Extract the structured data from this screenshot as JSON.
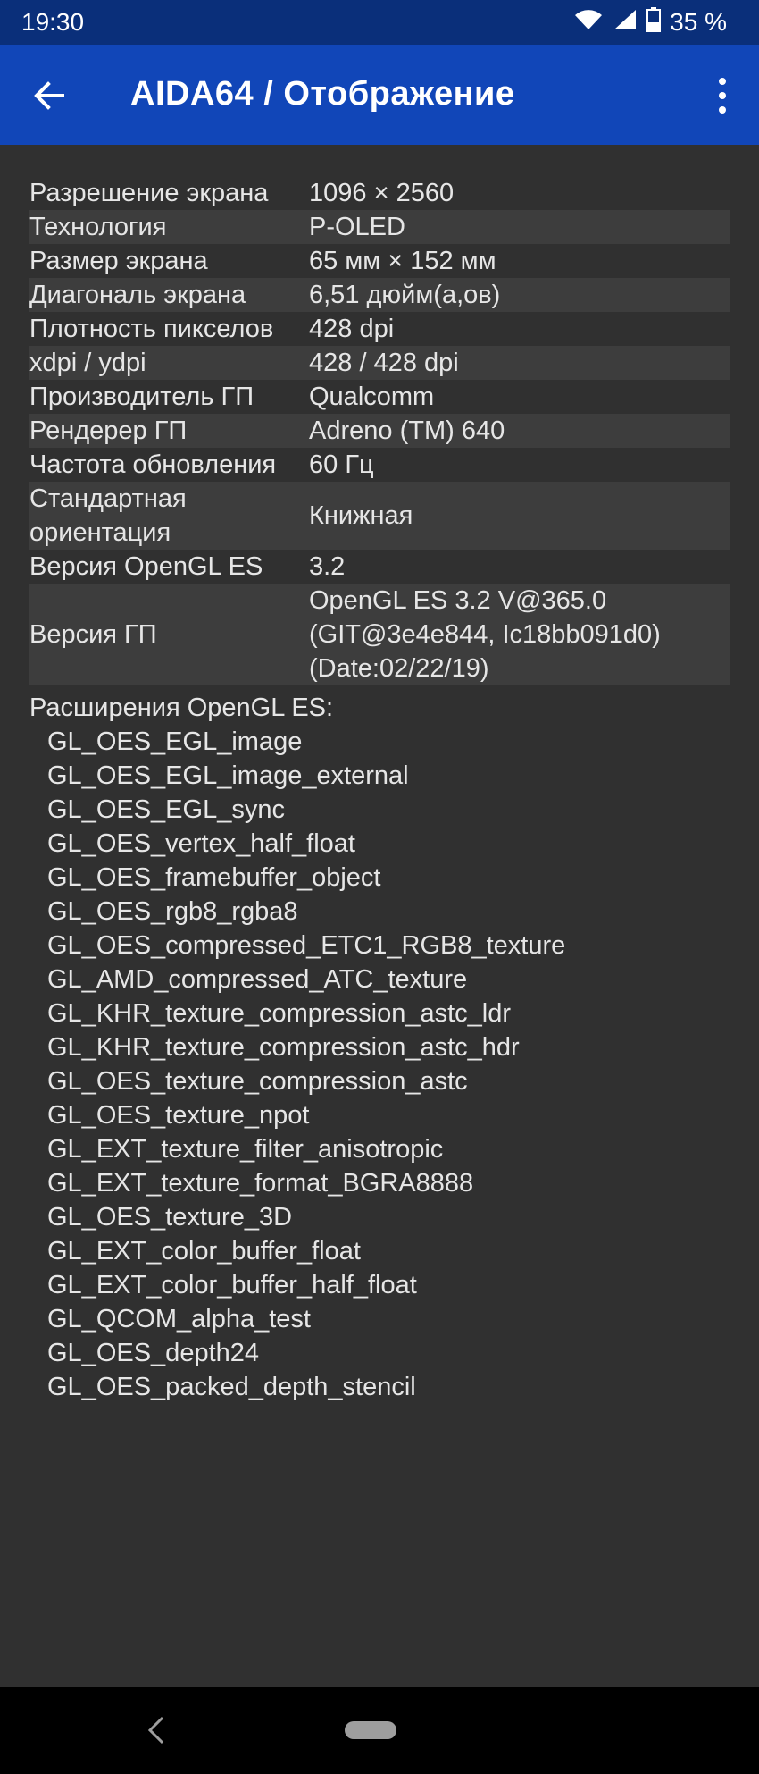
{
  "status_bar": {
    "time": "19:30",
    "battery": "35 %",
    "icons": [
      "wifi-icon",
      "signal-icon",
      "battery-icon"
    ]
  },
  "app_bar": {
    "title": "AIDA64  /  Отображение",
    "back_icon": "arrow-left-icon",
    "menu_icon": "more-vert-icon",
    "color": "#1146b8"
  },
  "rows": [
    {
      "label": "Разрешение экрана",
      "value": "1096 × 2560",
      "shaded": false
    },
    {
      "label": "Технология",
      "value": "P-OLED",
      "shaded": true
    },
    {
      "label": "Размер экрана",
      "value": "65 мм × 152 мм",
      "shaded": false
    },
    {
      "label": "Диагональ экрана",
      "value": "6,51 дюйм(а,ов)",
      "shaded": true
    },
    {
      "label": "Плотность пикселов",
      "value": "428 dpi",
      "shaded": false
    },
    {
      "label": "xdpi / ydpi",
      "value": "428 / 428 dpi",
      "shaded": true
    },
    {
      "label": "Производитель ГП",
      "value": "Qualcomm",
      "shaded": false
    },
    {
      "label": "Рендерер ГП",
      "value": "Adreno (TM) 640",
      "shaded": true
    },
    {
      "label": "Частота обновления",
      "value": "60 Гц",
      "shaded": false
    },
    {
      "label": "Стандартная ориентация",
      "value": "Книжная",
      "shaded": true
    },
    {
      "label": "Версия OpenGL ES",
      "value": "3.2",
      "shaded": false
    },
    {
      "label": "Версия ГП",
      "value": "OpenGL ES 3.2 V@365.0 (GIT@3e4e844, Ic18bb091d0) (Date:02/22/19)",
      "shaded": true
    }
  ],
  "extensions": {
    "header": "Расширения OpenGL ES:",
    "items": [
      "GL_OES_EGL_image",
      "GL_OES_EGL_image_external",
      "GL_OES_EGL_sync",
      "GL_OES_vertex_half_float",
      "GL_OES_framebuffer_object",
      "GL_OES_rgb8_rgba8",
      "GL_OES_compressed_ETC1_RGB8_texture",
      "GL_AMD_compressed_ATC_texture",
      "GL_KHR_texture_compression_astc_ldr",
      "GL_KHR_texture_compression_astc_hdr",
      "GL_OES_texture_compression_astc",
      "GL_OES_texture_npot",
      "GL_EXT_texture_filter_anisotropic",
      "GL_EXT_texture_format_BGRA8888",
      "GL_OES_texture_3D",
      "GL_EXT_color_buffer_float",
      "GL_EXT_color_buffer_half_float",
      "GL_QCOM_alpha_test",
      "GL_OES_depth24",
      "GL_OES_packed_depth_stencil"
    ]
  },
  "nav_bar": {
    "back_icon": "nav-back-icon",
    "home_icon": "nav-home-pill"
  }
}
